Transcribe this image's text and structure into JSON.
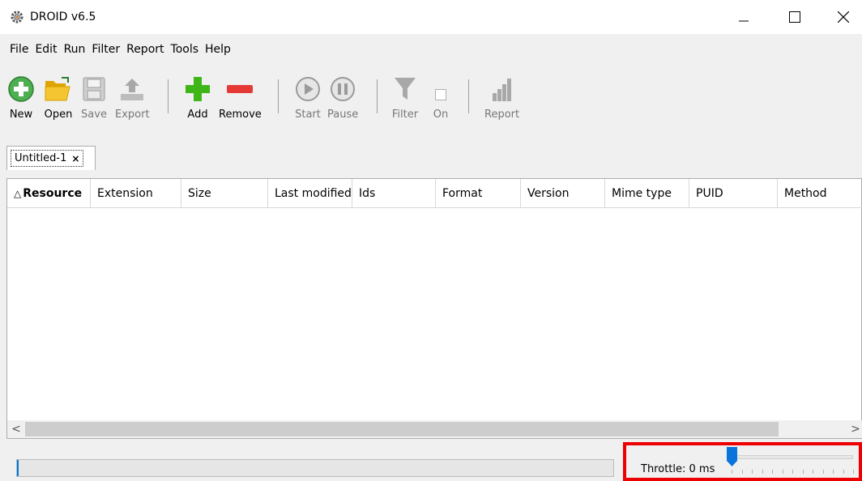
{
  "window": {
    "title": "DROID v6.5",
    "icon": "gear-icon",
    "controls": {
      "minimize": "minimize-icon",
      "maximize": "maximize-icon",
      "close": "close-icon"
    }
  },
  "menubar": {
    "items": [
      {
        "label": "File"
      },
      {
        "label": "Edit"
      },
      {
        "label": "Run"
      },
      {
        "label": "Filter"
      },
      {
        "label": "Report"
      },
      {
        "label": "Tools"
      },
      {
        "label": "Help"
      }
    ]
  },
  "toolbar": {
    "new_label": "New",
    "open_label": "Open",
    "save_label": "Save",
    "export_label": "Export",
    "add_label": "Add",
    "remove_label": "Remove",
    "start_label": "Start",
    "pause_label": "Pause",
    "filter_label": "Filter",
    "filter_on_label": "On",
    "report_label": "Report"
  },
  "tabs": [
    {
      "label": "Untitled-1",
      "close": "×"
    }
  ],
  "table": {
    "columns": [
      {
        "label": "Resource",
        "sorted": "ascending"
      },
      {
        "label": "Extension"
      },
      {
        "label": "Size"
      },
      {
        "label": "Last modified"
      },
      {
        "label": "Ids"
      },
      {
        "label": "Format"
      },
      {
        "label": "Version"
      },
      {
        "label": "Mime type"
      },
      {
        "label": "PUID"
      },
      {
        "label": "Method"
      }
    ],
    "rows": []
  },
  "scrollbar": {
    "left_arrow": "<",
    "right_arrow": ">"
  },
  "status": {
    "progress": 0,
    "throttle_label": "Throttle: 0 ms",
    "throttle_value_ms": 0
  },
  "colors": {
    "highlight": "#ee0000",
    "add": "#3fb618",
    "remove": "#e53935",
    "new": "#4caf50",
    "open": "#f5b700",
    "slider_thumb": "#0a74da"
  }
}
